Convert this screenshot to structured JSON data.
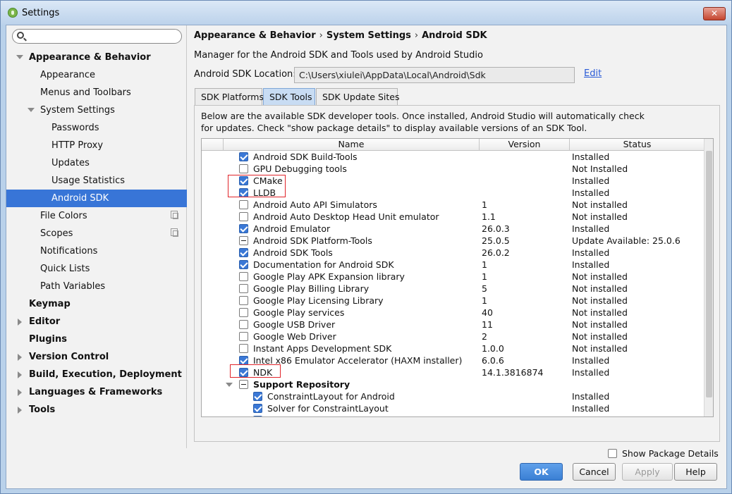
{
  "window": {
    "title": "Settings",
    "close": "✕"
  },
  "search": {
    "placeholder": ""
  },
  "tree": {
    "appearance_behavior": "Appearance & Behavior",
    "appearance": "Appearance",
    "menus_toolbars": "Menus and Toolbars",
    "system_settings": "System Settings",
    "passwords": "Passwords",
    "http_proxy": "HTTP Proxy",
    "updates": "Updates",
    "usage_statistics": "Usage Statistics",
    "android_sdk": "Android SDK",
    "file_colors": "File Colors",
    "scopes": "Scopes",
    "notifications": "Notifications",
    "quick_lists": "Quick Lists",
    "path_variables": "Path Variables",
    "keymap": "Keymap",
    "editor": "Editor",
    "plugins": "Plugins",
    "version_control": "Version Control",
    "build": "Build, Execution, Deployment",
    "languages": "Languages & Frameworks",
    "tools": "Tools"
  },
  "breadcrumb": {
    "p1": "Appearance & Behavior",
    "p2": "System Settings",
    "p3": "Android SDK",
    "sep": "›"
  },
  "description": "Manager for the Android SDK and Tools used by Android Studio",
  "location": {
    "label": "Android SDK Location:",
    "value": "C:\\Users\\xiulei\\AppData\\Local\\Android\\Sdk",
    "edit": "Edit"
  },
  "tabs": {
    "platforms": "SDK Platforms",
    "tools": "SDK Tools",
    "update_sites": "SDK Update Sites"
  },
  "info": {
    "line1": "Below are the available SDK developer tools. Once installed, Android Studio will automatically check",
    "line2": "for updates. Check \"show package details\" to display available versions of an SDK Tool."
  },
  "table": {
    "headers": {
      "name": "Name",
      "version": "Version",
      "status": "Status"
    },
    "rows": [
      {
        "name": "Android SDK Build-Tools",
        "version": "",
        "status": "Installed",
        "check": "checked"
      },
      {
        "name": "GPU Debugging tools",
        "version": "",
        "status": "Not Installed",
        "check": "unchecked"
      },
      {
        "name": "CMake",
        "version": "",
        "status": "Installed",
        "check": "checked"
      },
      {
        "name": "LLDB",
        "version": "",
        "status": "Installed",
        "check": "checked"
      },
      {
        "name": "Android Auto API Simulators",
        "version": "1",
        "status": "Not installed",
        "check": "unchecked"
      },
      {
        "name": "Android Auto Desktop Head Unit emulator",
        "version": "1.1",
        "status": "Not installed",
        "check": "unchecked"
      },
      {
        "name": "Android Emulator",
        "version": "26.0.3",
        "status": "Installed",
        "check": "checked"
      },
      {
        "name": "Android SDK Platform-Tools",
        "version": "25.0.5",
        "status": "Update Available: 25.0.6",
        "check": "partial"
      },
      {
        "name": "Android SDK Tools",
        "version": "26.0.2",
        "status": "Installed",
        "check": "checked"
      },
      {
        "name": "Documentation for Android SDK",
        "version": "1",
        "status": "Installed",
        "check": "checked"
      },
      {
        "name": "Google Play APK Expansion library",
        "version": "1",
        "status": "Not installed",
        "check": "unchecked"
      },
      {
        "name": "Google Play Billing Library",
        "version": "5",
        "status": "Not installed",
        "check": "unchecked"
      },
      {
        "name": "Google Play Licensing Library",
        "version": "1",
        "status": "Not installed",
        "check": "unchecked"
      },
      {
        "name": "Google Play services",
        "version": "40",
        "status": "Not installed",
        "check": "unchecked"
      },
      {
        "name": "Google USB Driver",
        "version": "11",
        "status": "Not installed",
        "check": "unchecked"
      },
      {
        "name": "Google Web Driver",
        "version": "2",
        "status": "Not installed",
        "check": "unchecked"
      },
      {
        "name": "Instant Apps Development SDK",
        "version": "1.0.0",
        "status": "Not installed",
        "check": "unchecked"
      },
      {
        "name": "Intel x86 Emulator Accelerator (HAXM installer)",
        "version": "6.0.6",
        "status": "Installed",
        "check": "checked"
      },
      {
        "name": "NDK",
        "version": "14.1.3816874",
        "status": "Installed",
        "check": "checked"
      }
    ],
    "group": {
      "name": "Support Repository",
      "check": "partial"
    },
    "children": [
      {
        "name": "ConstraintLayout for Android",
        "version": "",
        "status": "Installed",
        "check": "checked"
      },
      {
        "name": "Solver for ConstraintLayout",
        "version": "",
        "status": "Installed",
        "check": "checked"
      },
      {
        "name": "",
        "version": "",
        "status": "Installed",
        "check": "checked"
      }
    ]
  },
  "show_details": "Show Package Details",
  "buttons": {
    "ok": "OK",
    "cancel": "Cancel",
    "apply": "Apply",
    "help": "Help"
  },
  "colors": {
    "selection": "#3875d7",
    "highlight_box": "#e0242a",
    "primary_button": "#3a7fd4"
  }
}
